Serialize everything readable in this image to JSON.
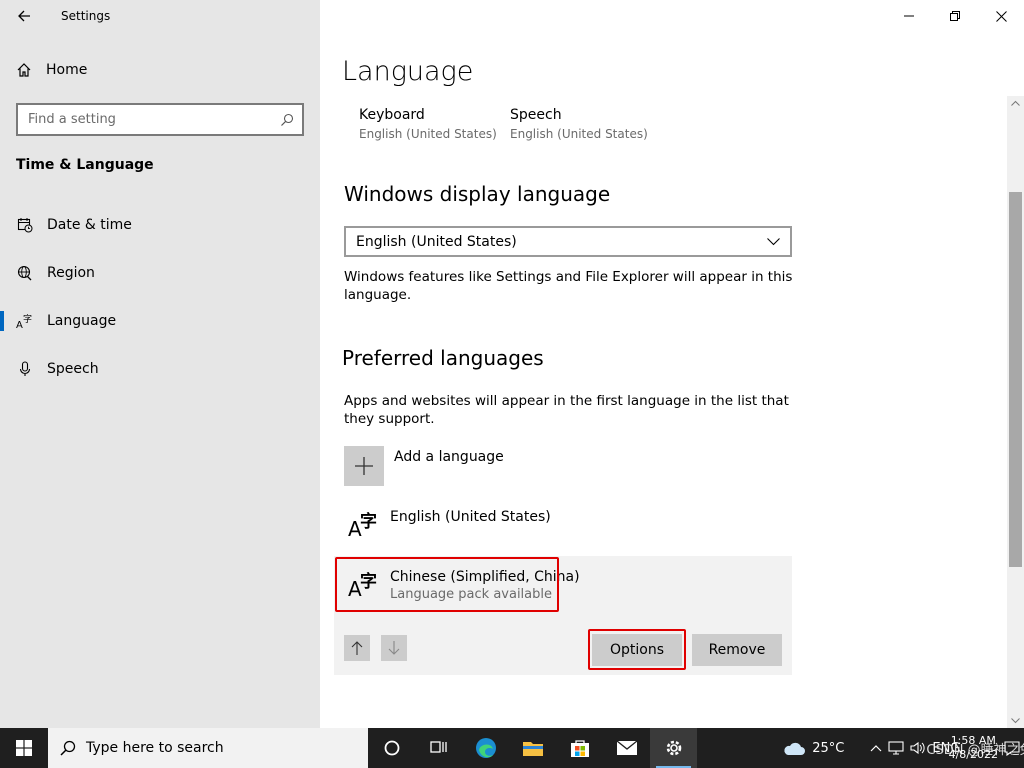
{
  "window": {
    "app_title": "Settings"
  },
  "sidebar": {
    "home_label": "Home",
    "search_placeholder": "Find a setting",
    "section_title": "Time & Language",
    "items": [
      {
        "label": "Date & time",
        "icon": "calendar-clock-icon"
      },
      {
        "label": "Region",
        "icon": "globe-icon"
      },
      {
        "label": "Language",
        "icon": "language-icon",
        "active": true
      },
      {
        "label": "Speech",
        "icon": "microphone-icon"
      }
    ]
  },
  "main": {
    "page_title": "Language",
    "quick": [
      {
        "title": "Keyboard",
        "sub": "English (United States)"
      },
      {
        "title": "Speech",
        "sub": "English (United States)"
      }
    ],
    "display_heading": "Windows display language",
    "display_value": "English (United States)",
    "display_desc": "Windows features like Settings and File Explorer will appear in this language.",
    "preferred_heading": "Preferred languages",
    "preferred_desc": "Apps and websites will appear in the first language in the list that they support.",
    "add_label": "Add a language",
    "languages": [
      {
        "name": "English (United States)",
        "sub": ""
      },
      {
        "name": "Chinese (Simplified, China)",
        "sub": "Language pack available"
      }
    ],
    "options_label": "Options",
    "remove_label": "Remove"
  },
  "taskbar": {
    "search_placeholder": "Type here to search",
    "weather": "25°C",
    "ime": "ENG",
    "time": "1:58 AM",
    "date": "4/8/2022",
    "watermark": "CSDN @睡神之兔"
  },
  "colors": {
    "accent": "#0067c0",
    "highlight": "#e00000",
    "sidebar_bg": "#e6e6e6",
    "taskbar_bg": "#1f1f1f"
  }
}
